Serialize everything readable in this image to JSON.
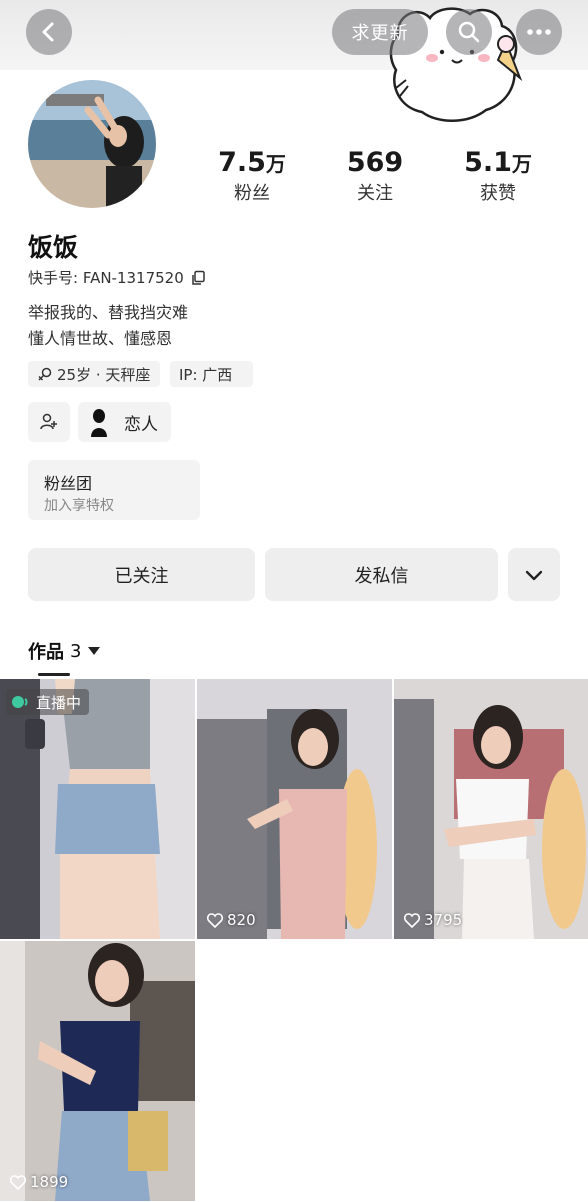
{
  "header": {
    "update_label": "求更新"
  },
  "stats": [
    {
      "num": "7.5",
      "unit": "万",
      "label": "粉丝"
    },
    {
      "num": "569",
      "unit": "",
      "label": "关注"
    },
    {
      "num": "5.1",
      "unit": "万",
      "label": "获赞"
    }
  ],
  "profile": {
    "name": "饭饭",
    "kuaishou_id": "快手号: FAN-1317520",
    "bio": [
      "举报我的、替我挡灾难",
      "懂人情世故、懂感恩"
    ],
    "tags": {
      "age_sign": "25岁 · 天秤座",
      "ip": "IP: 广西"
    },
    "partner_label": "恋人",
    "fan_group": {
      "title": "粉丝团",
      "subtitle": "加入享特权"
    }
  },
  "actions": {
    "followed": "已关注",
    "message": "发私信"
  },
  "works": {
    "label": "作品",
    "count": "3",
    "items": [
      {
        "live": "直播中",
        "likes": ""
      },
      {
        "live": "",
        "likes": "820"
      },
      {
        "live": "",
        "likes": "3795"
      },
      {
        "live": "",
        "likes": "1899"
      }
    ]
  },
  "colors": {
    "live_dot": "#3ec9a0",
    "button_bg": "#eeeeef"
  }
}
